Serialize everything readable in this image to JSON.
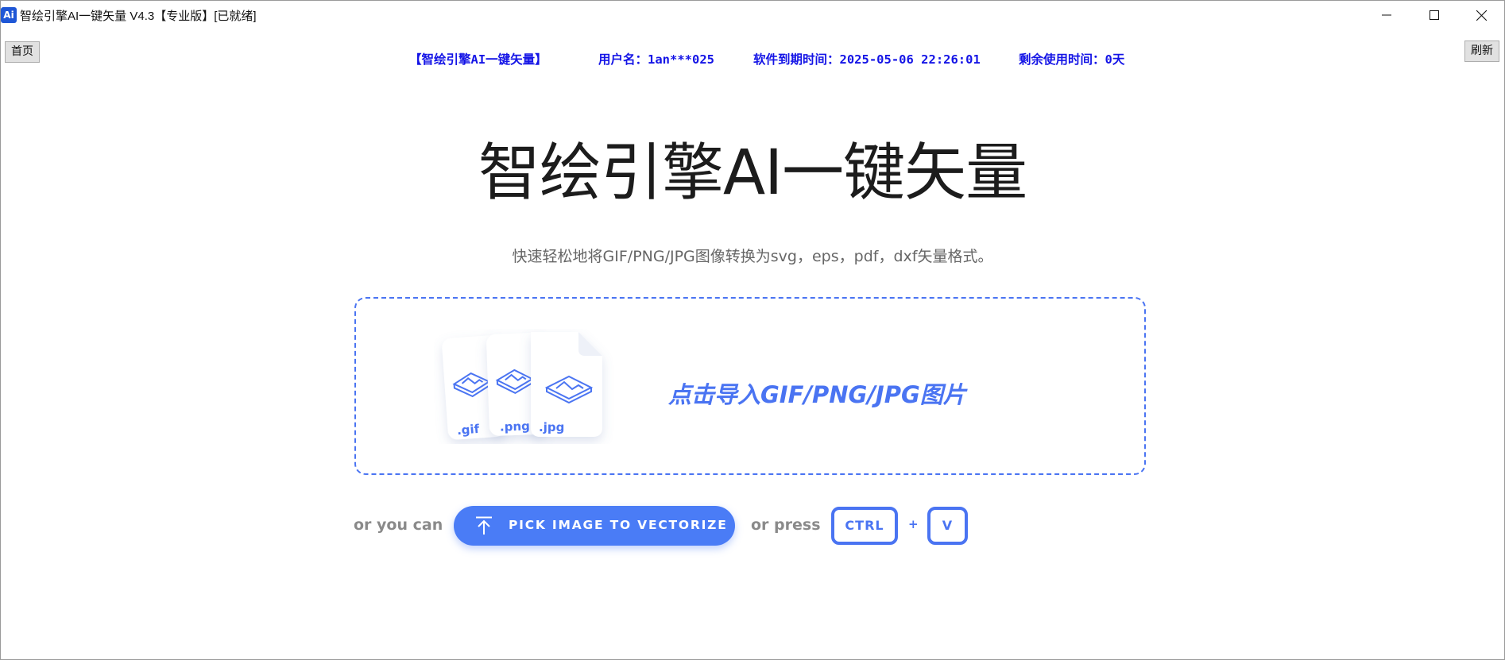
{
  "window": {
    "icon_text": "Ai",
    "title": "智绘引擎AI一键矢量 V4.3【专业版】[已就绪]",
    "controls": [
      "minimize-icon",
      "maximize-icon",
      "close-icon"
    ]
  },
  "toolbar": {
    "home_label": "首页",
    "refresh_label": "刷新"
  },
  "info": {
    "app_name": "【智绘引擎AI一键矢量】",
    "username": "用户名：1an***025",
    "expiry": "软件到期时间：2025-05-06 22:26:01",
    "remaining": "剩余使用时间：0天"
  },
  "hero": {
    "title": "智绘引擎AI一键矢量",
    "subtitle": "快速轻松地将GIF/PNG/JPG图像转换为svg，eps，pdf，dxf矢量格式。"
  },
  "dropzone": {
    "label": "点击导入GIF/PNG/JPG图片",
    "file_types": [
      ".gif",
      ".png",
      ".jpg"
    ]
  },
  "actions": {
    "or_you_can": "or you can",
    "pick_button": "PICK IMAGE TO VECTORIZE",
    "or_press": "or press",
    "key_ctrl": "CTRL",
    "plus": "+",
    "key_v": "V"
  },
  "colors": {
    "accent": "#4a74f2",
    "button": "#4a7cf6",
    "info_text": "#1414e6"
  }
}
